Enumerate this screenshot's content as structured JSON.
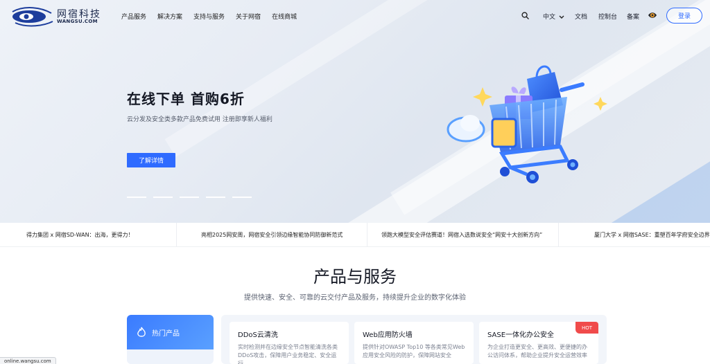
{
  "header": {
    "logo": {
      "cn": "网宿科技",
      "en": "WANGSU.COM"
    },
    "nav": [
      "产品服务",
      "解决方案",
      "支持与服务",
      "关于网宿",
      "在线商城"
    ],
    "right": {
      "language": "中文",
      "docs": "文档",
      "console": "控制台",
      "filing": "备案",
      "login": "登录"
    },
    "icons": [
      "search-icon",
      "chevron-down-icon",
      "eye-icon"
    ]
  },
  "hero": {
    "title": "在线下单 首购6折",
    "subtitle": "云分发及安全类多款产品免费试用 注册即享新人福利",
    "button": "了解详情",
    "slides": 5
  },
  "ticker": [
    "得力集团 x 网宿SD-WAN：出海，更得力！",
    "亮相2025网安周，网宿安全引领边缘智能协同防御新范式",
    "领跑大模型安全评估赛道！网宿入选数说安全“网安十大创新方向”",
    "厦门大学 x 网宿SASE：重塑百年学府安全边界"
  ],
  "products": {
    "title": "产品与服务",
    "subtitle": "提供快速、安全、可靠的云交付产品及服务，持续提升企业的数字化体验",
    "side": {
      "active": "热门产品"
    },
    "cards": [
      {
        "title": "DDoS云清洗",
        "desc_1": "实时检测并在边缘安全节点智能清洗各类",
        "desc_2": "DDoS攻击，保障用户业务稳定、安全运",
        "desc_3": "行"
      },
      {
        "title": "Web应用防火墙",
        "desc_1": "提供针对OWASP Top10 等各类常见Web",
        "desc_2": "应用安全风险的防护，保障网站安全",
        "desc_3": ""
      },
      {
        "title": "SASE一体化办公安全",
        "desc_1": "为企业打造更安全、更高效、更便捷的办",
        "desc_2": "公访问体系，帮助企业提升安全运营效率",
        "desc_3": ""
      }
    ],
    "badge": "HOT"
  },
  "status": {
    "url": "online.wangsu.com"
  },
  "colors": {
    "primary": "#2f6bff",
    "hot": "#f04b4b"
  }
}
